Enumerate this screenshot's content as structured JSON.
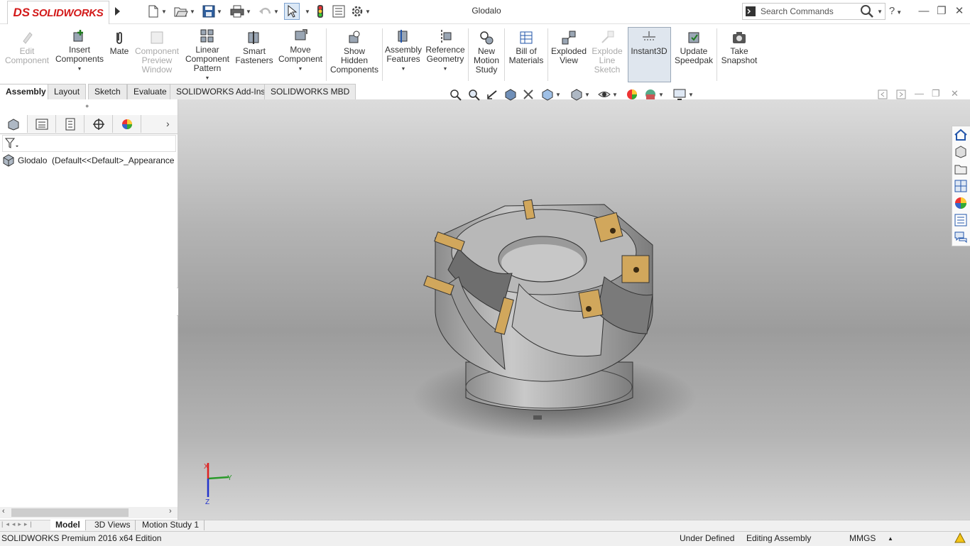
{
  "app": {
    "brand_ds": "DS",
    "brand_name": "SOLIDWORKS",
    "document_title": "Glodalo"
  },
  "search": {
    "placeholder": "Search Commands"
  },
  "commands": [
    {
      "id": "edit-component",
      "label": "Edit\nComponent",
      "disabled": true
    },
    {
      "id": "insert-components",
      "label": "Insert\nComponents",
      "disabled": false,
      "dropdown": true
    },
    {
      "id": "mate",
      "label": "Mate",
      "disabled": false
    },
    {
      "id": "component-preview-window",
      "label": "Component\nPreview\nWindow",
      "disabled": true
    },
    {
      "id": "linear-component-pattern",
      "label": "Linear\nComponent\nPattern",
      "disabled": false,
      "dropdown": true
    },
    {
      "id": "smart-fasteners",
      "label": "Smart\nFasteners",
      "disabled": false
    },
    {
      "id": "move-component",
      "label": "Move\nComponent",
      "disabled": false,
      "dropdown": true
    },
    {
      "id": "show-hidden-components",
      "label": "Show\nHidden\nComponents",
      "disabled": false
    },
    {
      "id": "assembly-features",
      "label": "Assembly\nFeatures",
      "disabled": false,
      "dropdown": true
    },
    {
      "id": "reference-geometry",
      "label": "Reference\nGeometry",
      "disabled": false,
      "dropdown": true
    },
    {
      "id": "new-motion-study",
      "label": "New\nMotion\nStudy",
      "disabled": false
    },
    {
      "id": "bill-of-materials",
      "label": "Bill of\nMaterials",
      "disabled": false
    },
    {
      "id": "exploded-view",
      "label": "Exploded\nView",
      "disabled": false
    },
    {
      "id": "explode-line-sketch",
      "label": "Explode\nLine\nSketch",
      "disabled": true
    },
    {
      "id": "instant3d",
      "label": "Instant3D",
      "disabled": false,
      "active": true
    },
    {
      "id": "update-speedpak",
      "label": "Update\nSpeedpak",
      "disabled": false
    },
    {
      "id": "take-snapshot",
      "label": "Take\nSnapshot",
      "disabled": false
    }
  ],
  "tabs": [
    "Assembly",
    "Layout",
    "Sketch",
    "Evaluate",
    "SOLIDWORKS Add-Ins",
    "SOLIDWORKS MBD"
  ],
  "active_tab": "Assembly",
  "tree": {
    "root_label": "Glodalo  (Default<<Default>_Appearance"
  },
  "bottom_tabs": [
    "Model",
    "3D Views",
    "Motion Study 1"
  ],
  "active_bottom_tab": "Model",
  "status": {
    "edition": "SOLIDWORKS Premium 2016 x64 Edition",
    "definition": "Under Defined",
    "mode": "Editing Assembly",
    "units": "MMGS"
  },
  "triad": {
    "x": "X",
    "y": "Y",
    "z": "Z"
  },
  "colors": {
    "brand_red": "#d31a1a",
    "insert_gold": "#d1a75c",
    "body_grey": "#a8a8a8"
  },
  "icons": {
    "quick_access": [
      "new-document-icon",
      "open-icon",
      "save-icon",
      "print-icon",
      "undo-icon",
      "select-icon",
      "rebuild-icon",
      "file-properties-icon",
      "options-icon"
    ],
    "heads_up": [
      "zoom-to-fit-icon",
      "zoom-to-area-icon",
      "previous-view-icon",
      "section-view-icon",
      "dynamic-annotation-icon",
      "view-orientation-icon",
      "display-style-icon",
      "hide-show-items-icon",
      "edit-appearance-icon",
      "apply-scene-icon",
      "view-settings-icon"
    ],
    "task_pane": [
      "solidworks-resources-icon",
      "design-library-icon",
      "file-explorer-icon",
      "view-palette-icon",
      "appearances-icon",
      "custom-properties-icon",
      "forum-icon"
    ]
  }
}
